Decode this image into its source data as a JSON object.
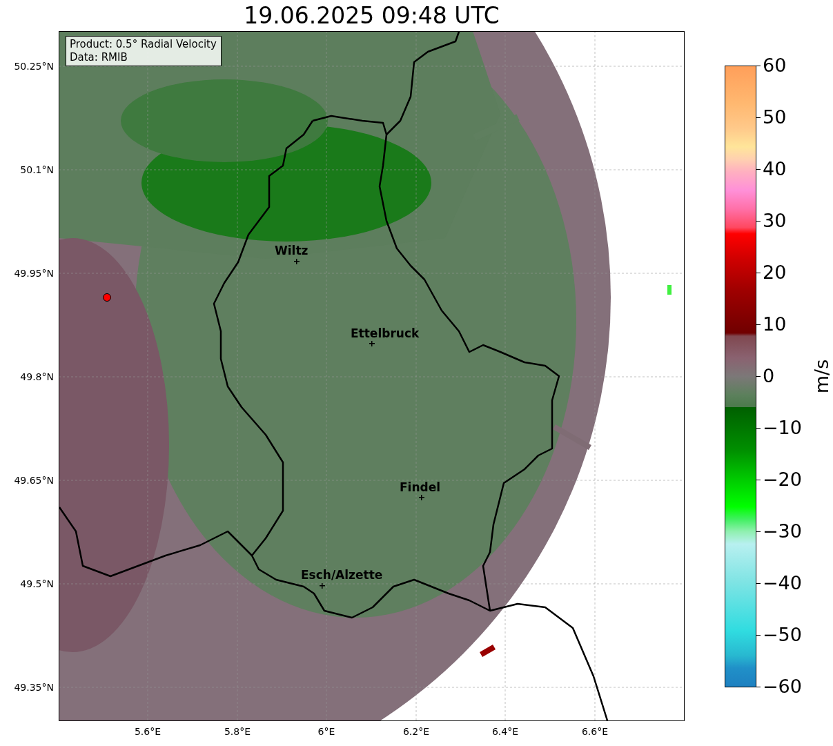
{
  "title": "19.06.2025 09:48 UTC",
  "map": {
    "info_box": [
      "Product: 0.5° Radial Velocity",
      "Data: RMIB"
    ],
    "cities": [
      {
        "name": "Wiltz"
      },
      {
        "name": "Ettelbruck"
      },
      {
        "name": "Findel"
      },
      {
        "name": "Esch/Alzette"
      }
    ],
    "lat_ticks": [
      "50.25°N",
      "50.1°N",
      "49.95°N",
      "49.8°N",
      "49.65°N",
      "49.5°N",
      "49.35°N"
    ],
    "lon_ticks": [
      "5.6°E",
      "5.8°E",
      "6°E",
      "6.2°E",
      "6.4°E",
      "6.6°E"
    ]
  },
  "colorbar": {
    "label": "m/s",
    "ticks": [
      "60",
      "50",
      "40",
      "30",
      "20",
      "10",
      "0",
      "−10",
      "−20",
      "−30",
      "−40",
      "−50",
      "−60"
    ]
  }
}
